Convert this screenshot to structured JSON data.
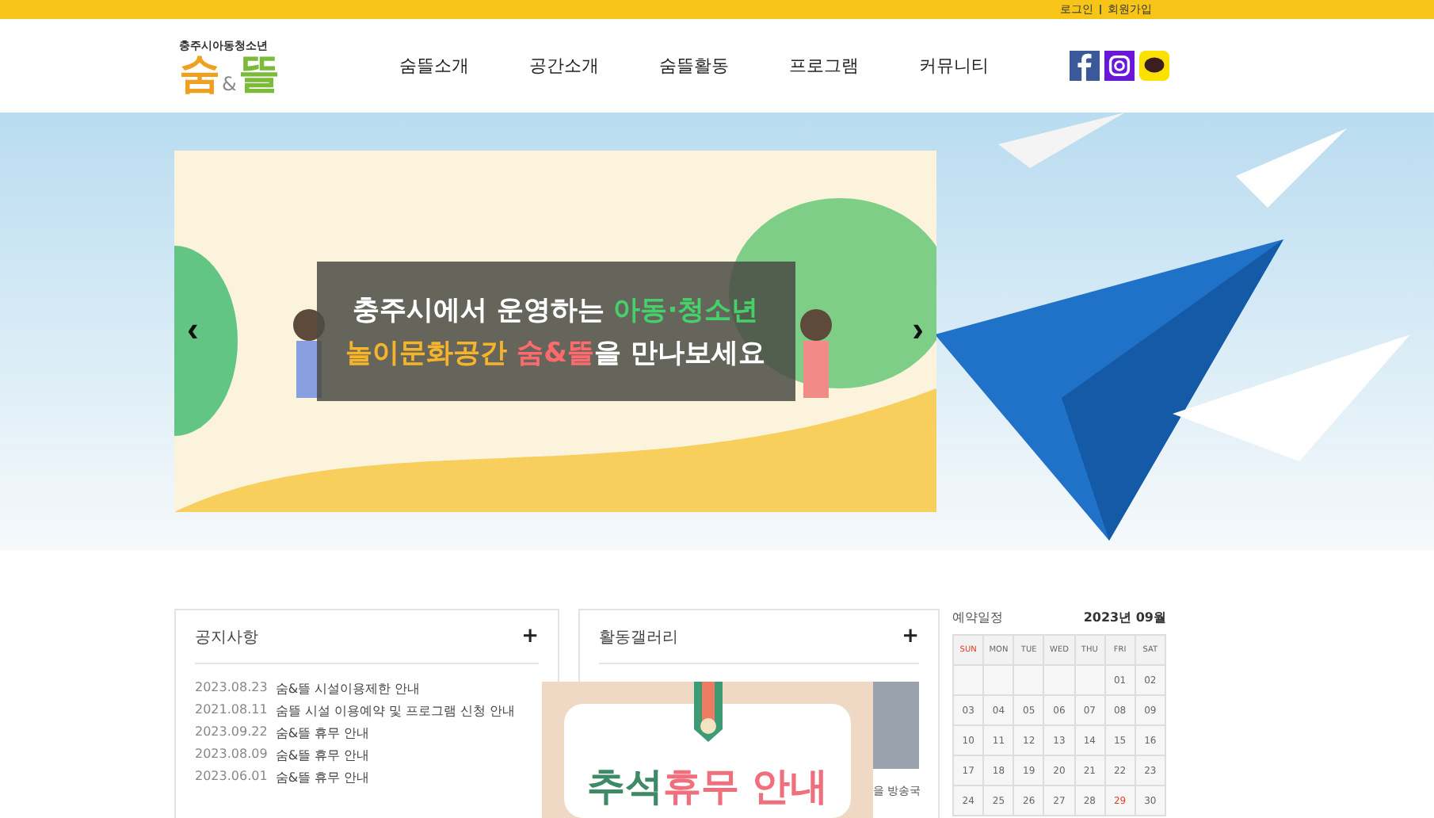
{
  "top_links": [
    "로그인",
    "회원가입"
  ],
  "logo": {
    "subtitle": "충주시아동청소년",
    "name_left": "숨",
    "amp": "&",
    "name_right": "뜰"
  },
  "nav": [
    "숨뜰소개",
    "공간소개",
    "숨뜰활동",
    "프로그램",
    "커뮤니티"
  ],
  "banner": {
    "prev": "‹",
    "next": "›",
    "line1": "충주시에서 운영하는 **아동·청소년**",
    "line2_highlight": "놀이문화공간",
    "line2_brand": "숨&뜰",
    "line2_rest": "을 만나보세요"
  },
  "notice": {
    "title": "공지사항",
    "more": "+",
    "items": [
      {
        "date": "2023.08.23",
        "title": "숨&뜰 시설이용제한 안내"
      },
      {
        "date": "2021.08.11",
        "title": "숨뜰 시설 이용예약 및 프로그램 신청 안내"
      },
      {
        "date": "2023.09.22",
        "title": "숨&뜰 휴무 안내"
      },
      {
        "date": "2023.08.09",
        "title": "숨&뜰 휴무 안내"
      },
      {
        "date": "2023.06.01",
        "title": "숨&뜰 휴무 안내"
      }
    ]
  },
  "gallery": {
    "title": "활동갤러리",
    "more": "+",
    "caption": "을 방송국"
  },
  "popup": {
    "title_part1": "추석",
    "title_part2": "휴무 안내"
  },
  "calendar": {
    "title": "예약일정",
    "month": "2023년 09월",
    "weekdays": [
      "SUN",
      "MON",
      "TUE",
      "WED",
      "THU",
      "FRI",
      "SAT"
    ],
    "weeks": [
      [
        {
          "day": "01",
          "holiday": false
        },
        {
          "day": "02",
          "holiday": false
        }
      ],
      [
        {
          "day": "03",
          "holiday": false
        },
        {
          "day": "04",
          "holiday": false
        },
        {
          "day": "05",
          "holiday": false
        },
        {
          "day": "06",
          "holiday": false
        },
        {
          "day": "07",
          "holiday": false
        },
        {
          "day": "08",
          "holiday": false
        },
        {
          "day": "09",
          "holiday": false
        }
      ],
      [
        {
          "day": "10",
          "holiday": false
        },
        {
          "day": "11",
          "holiday": false
        },
        {
          "day": "12",
          "holiday": false
        },
        {
          "day": "13",
          "holiday": false
        },
        {
          "day": "14",
          "holiday": false
        },
        {
          "day": "15",
          "holiday": false
        },
        {
          "day": "16",
          "holiday": false
        }
      ],
      [
        {
          "day": "17",
          "holiday": false
        },
        {
          "day": "18",
          "holiday": false
        },
        {
          "day": "19",
          "holiday": false
        },
        {
          "day": "20",
          "holiday": false
        },
        {
          "day": "21",
          "holiday": false
        },
        {
          "day": "22",
          "holiday": false
        },
        {
          "day": "23",
          "holiday": false
        }
      ],
      [
        {
          "day": "24",
          "holiday": false
        },
        {
          "day": "25",
          "holiday": false
        },
        {
          "day": "26",
          "holiday": false
        },
        {
          "day": "27",
          "holiday": false
        },
        {
          "day": "28",
          "holiday": false
        },
        {
          "day": "29",
          "holiday": true
        },
        {
          "day": "30",
          "holiday": false
        }
      ]
    ]
  }
}
